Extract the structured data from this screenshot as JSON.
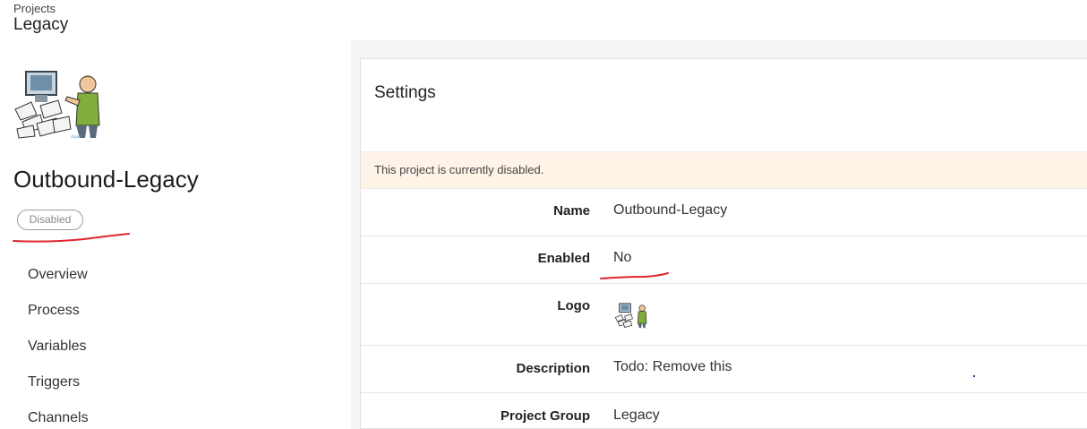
{
  "breadcrumb": {
    "parent": "Projects",
    "current": "Legacy"
  },
  "sidebar": {
    "project_name": "Outbound-Legacy",
    "status_badge": "Disabled",
    "nav": [
      {
        "label": "Overview"
      },
      {
        "label": "Process"
      },
      {
        "label": "Variables"
      },
      {
        "label": "Triggers"
      },
      {
        "label": "Channels"
      }
    ]
  },
  "settings": {
    "title": "Settings",
    "alert": "This project is currently disabled.",
    "fields": [
      {
        "label": "Name",
        "value": "Outbound-Legacy"
      },
      {
        "label": "Enabled",
        "value": "No"
      },
      {
        "label": "Logo",
        "value": ""
      },
      {
        "label": "Description",
        "value": "Todo: Remove this"
      },
      {
        "label": "Project Group",
        "value": "Legacy"
      }
    ]
  },
  "colors": {
    "annotation": "#e0242f",
    "alert_bg": "#fdf3e7"
  },
  "icons": {
    "logo": "cartoon-person-with-computer-logo"
  }
}
